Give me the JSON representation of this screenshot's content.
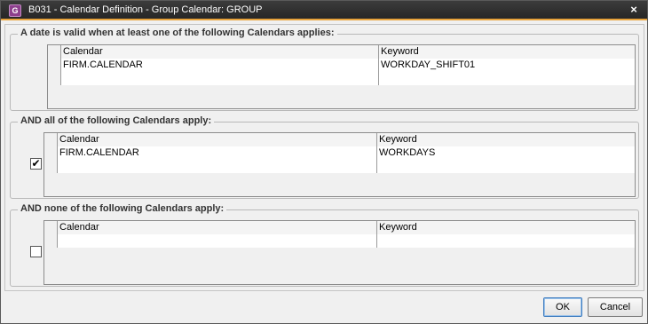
{
  "window": {
    "app_icon": "G",
    "title": "B031 - Calendar Definition - Group Calendar: GROUP",
    "close_glyph": "×"
  },
  "sections": [
    {
      "legend": "A date is valid when at least one of the following Calendars applies:",
      "columns": [
        "Calendar",
        "Keyword"
      ],
      "rows": [
        [
          "FIRM.CALENDAR",
          "WORKDAY_SHIFT01"
        ],
        [
          "",
          ""
        ]
      ]
    },
    {
      "legend": "AND all of the following Calendars apply:",
      "checked": true,
      "check_glyph": "✔",
      "columns": [
        "Calendar",
        "Keyword"
      ],
      "rows": [
        [
          "FIRM.CALENDAR",
          "WORKDAYS"
        ],
        [
          "",
          ""
        ]
      ]
    },
    {
      "legend": "AND none of the following Calendars apply:",
      "checked": false,
      "check_glyph": "",
      "columns": [
        "Calendar",
        "Keyword"
      ],
      "rows": [
        [
          "",
          ""
        ]
      ]
    }
  ],
  "buttons": {
    "ok": "OK",
    "cancel": "Cancel"
  }
}
